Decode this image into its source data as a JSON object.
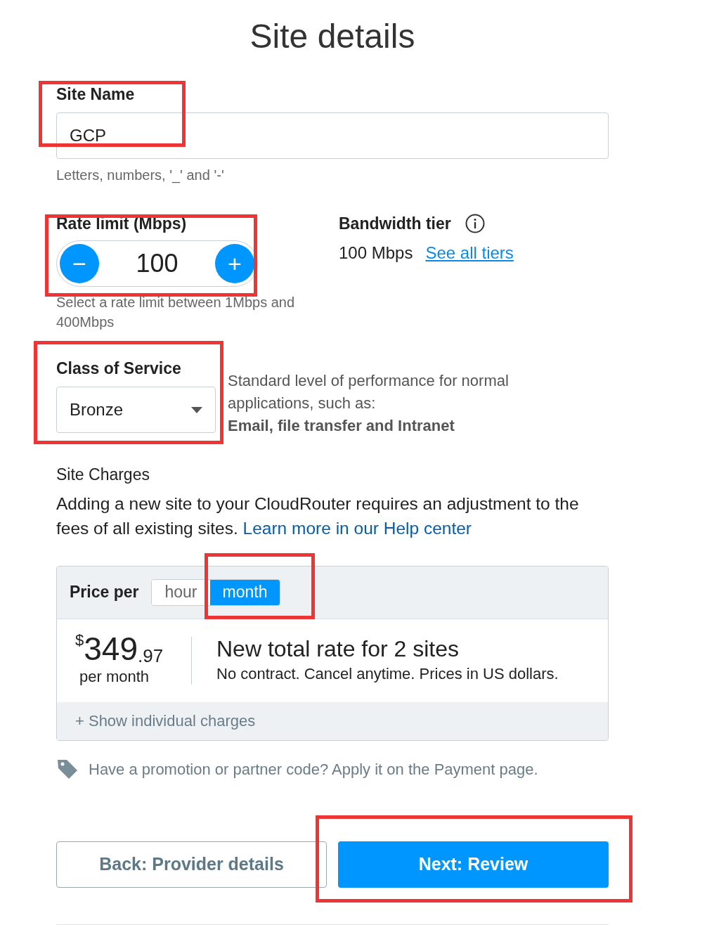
{
  "title": "Site details",
  "site_name": {
    "label": "Site Name",
    "value": "GCP",
    "hint": "Letters, numbers, '_' and '-'"
  },
  "rate_limit": {
    "label": "Rate limit (Mbps)",
    "minus": "−",
    "value": "100",
    "plus": "+",
    "hint": "Select a rate limit between 1Mbps and 400Mbps"
  },
  "bandwidth_tier": {
    "label": "Bandwidth tier",
    "value": "100 Mbps",
    "link": "See all tiers"
  },
  "class_of_service": {
    "label": "Class of Service",
    "value": "Bronze",
    "description": "Standard level of performance for normal applications, such as:",
    "examples": "Email, file transfer and Intranet"
  },
  "site_charges": {
    "heading": "Site Charges",
    "text": "Adding a new site to your CloudRouter requires an adjustment to the fees of all existing sites.",
    "link": "Learn more in our Help center"
  },
  "price": {
    "label": "Price per",
    "options": [
      {
        "label": "hour",
        "selected": false
      },
      {
        "label": "month",
        "selected": true
      }
    ],
    "currency": "$",
    "amount": "349",
    "cents": ".97",
    "period": "per month",
    "headline": "New total rate for 2 sites",
    "subtext": "No contract. Cancel anytime. Prices in US dollars.",
    "toggle_charges": "+ Show individual charges"
  },
  "promo": "Have a promotion or partner code? Apply it on the Payment page.",
  "buttons": [
    {
      "label": "Back: Provider details",
      "kind": "secondary"
    },
    {
      "label": "Next: Review",
      "kind": "primary"
    }
  ]
}
